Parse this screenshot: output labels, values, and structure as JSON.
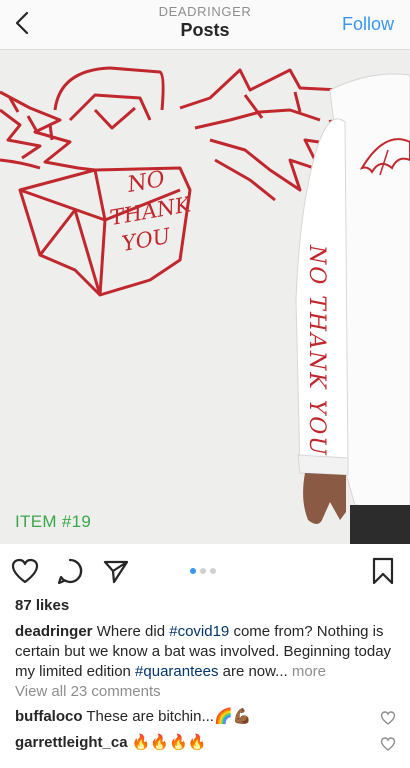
{
  "header": {
    "username": "DEADRINGER",
    "title": "Posts",
    "follow_label": "Follow"
  },
  "post": {
    "image_caption": "ITEM #19",
    "artwork_text": [
      "NO",
      "THANK",
      "YOU"
    ],
    "sleeve_text": "NO THANK YOU",
    "carousel_count": 3,
    "carousel_active": 1,
    "likes": "87 likes",
    "caption": {
      "username": "deadringer",
      "part1": " Where did ",
      "tag1": "#covid19",
      "part2": " come from? Nothing is certain but we know a bat was involved. Beginning today my limited edition ",
      "tag2": "#quarantees",
      "part3": " are now...",
      "more": " more"
    },
    "view_all": "View all 23 comments",
    "comments": [
      {
        "username": "buffaloco",
        "text": " These are bitchin...🌈💪🏾"
      },
      {
        "username": "garrettleight_ca",
        "text": " 🔥🔥🔥🔥"
      }
    ]
  },
  "colors": {
    "accent": "#3897f0",
    "caption_green": "#3aa84a",
    "print_red": "#c0282d"
  }
}
